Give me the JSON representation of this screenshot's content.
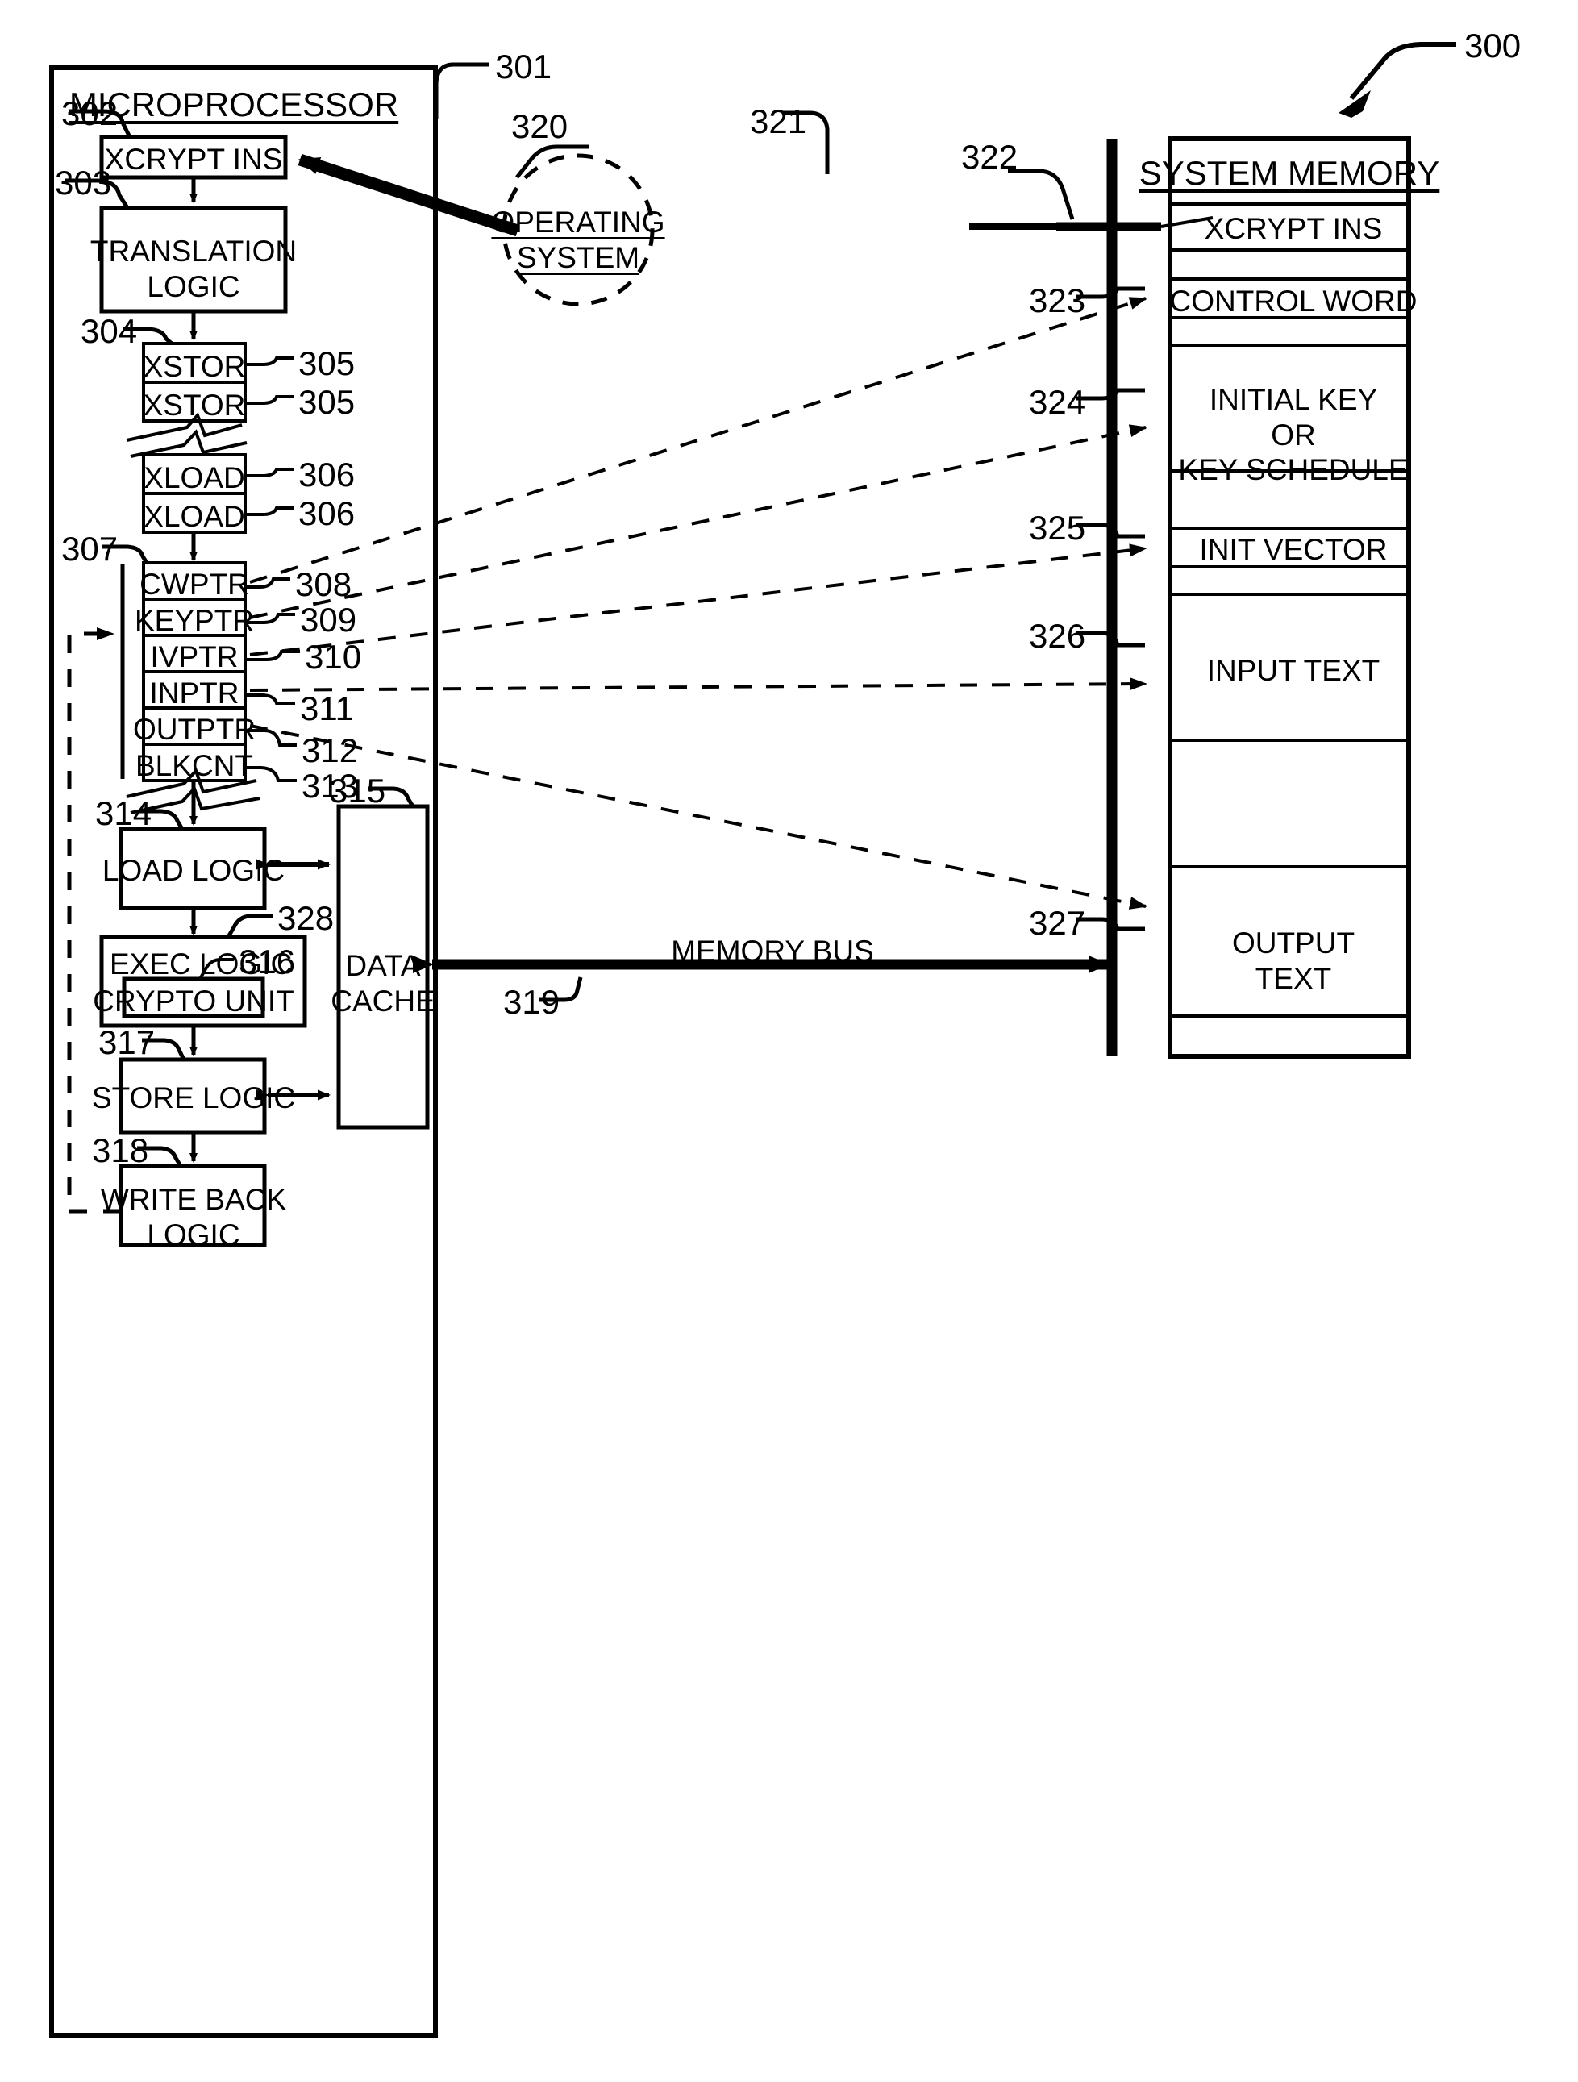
{
  "figure": {
    "number": "300",
    "type": "patent-block-diagram"
  },
  "microprocessor": {
    "title": "MICROPROCESSOR",
    "ref": "301",
    "blocks": {
      "xcrypt_ins": {
        "label": "XCRYPT INS",
        "ref": "302"
      },
      "translation_logic": {
        "label": "TRANSLATION\nLOGIC",
        "ref": "303"
      },
      "load_logic": {
        "label": "LOAD LOGIC",
        "ref": "314"
      },
      "exec_logic": {
        "label": "EXEC LOGIC",
        "ref": "328"
      },
      "crypto_unit": {
        "label": "CRYPTO UNIT",
        "ref": "316"
      },
      "store_logic": {
        "label": "STORE LOGIC",
        "ref": "317"
      },
      "write_back_logic": {
        "label": "WRITE BACK\nLOGIC",
        "ref": "318"
      },
      "data_cache": {
        "label": "DATA\nCACHE",
        "ref": "315"
      }
    },
    "micro_instruction_queue": {
      "ref": "304",
      "rows": [
        {
          "label": "XSTOR",
          "ref": "305"
        },
        {
          "label": "XSTOR",
          "ref": "305"
        },
        {
          "label": "XLOAD",
          "ref": "306"
        },
        {
          "label": "XLOAD",
          "ref": "306"
        }
      ]
    },
    "register_file": {
      "ref": "307",
      "rows": [
        {
          "label": "CWPTR",
          "ref": "308"
        },
        {
          "label": "KEYPTR",
          "ref": "309"
        },
        {
          "label": "IVPTR",
          "ref": "310"
        },
        {
          "label": "INPTR",
          "ref": "311"
        },
        {
          "label": "OUTPTR",
          "ref": "312"
        },
        {
          "label": "BLKCNT",
          "ref": "313"
        }
      ]
    }
  },
  "operating_system": {
    "label": "OPERATING\nSYSTEM",
    "ref": "320"
  },
  "memory_bus": {
    "label": "MEMORY BUS",
    "ref": "319"
  },
  "system_memory": {
    "title": "SYSTEM MEMORY",
    "ref": "321",
    "rows": [
      {
        "label": "XCRYPT INS",
        "ref": "322"
      },
      {
        "label": "",
        "ref": ""
      },
      {
        "label": "CONTROL WORD",
        "ref": "323"
      },
      {
        "label": "",
        "ref": ""
      },
      {
        "label": "INITIAL KEY\nOR\nKEY SCHEDULE",
        "ref": "324"
      },
      {
        "label": "",
        "ref": ""
      },
      {
        "label": "INIT VECTOR",
        "ref": "325"
      },
      {
        "label": "",
        "ref": ""
      },
      {
        "label": "INPUT TEXT",
        "ref": "326"
      },
      {
        "label": "",
        "ref": ""
      },
      {
        "label": "OUTPUT\nTEXT",
        "ref": "327"
      },
      {
        "label": "",
        "ref": ""
      }
    ]
  },
  "colors": {
    "line": "#000000",
    "background": "#ffffff"
  }
}
